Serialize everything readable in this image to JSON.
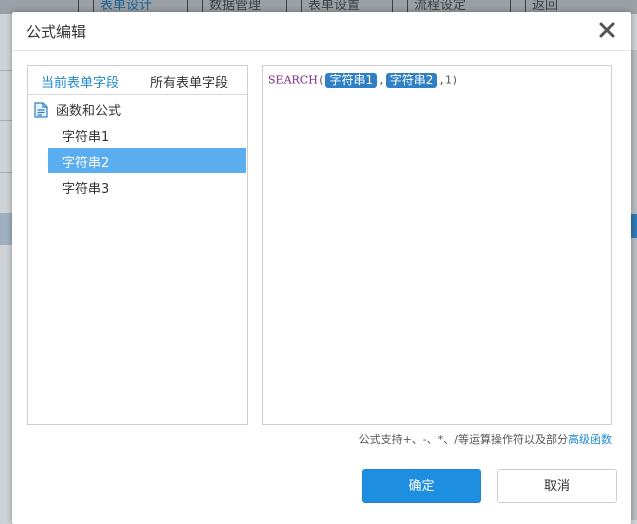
{
  "background_app": {
    "tabs": [
      {
        "label": "表单设计",
        "active": true
      },
      {
        "label": "数据管理",
        "active": false
      },
      {
        "label": "表单设置",
        "active": false
      },
      {
        "label": "流程设定",
        "active": false
      },
      {
        "label": "返回",
        "active": false
      }
    ]
  },
  "dialog": {
    "title": "公式编辑",
    "close_icon": "close-x-icon"
  },
  "left_panel": {
    "tabs": [
      {
        "label": "当前表单字段",
        "active": true
      },
      {
        "label": "所有表单字段",
        "active": false
      }
    ],
    "tree_root": {
      "label": "函数和公式",
      "icon": "document-icon"
    },
    "fields": [
      {
        "label": "字符串1",
        "selected": false
      },
      {
        "label": "字符串2",
        "selected": true
      },
      {
        "label": "字符串3",
        "selected": false
      }
    ]
  },
  "formula": {
    "function": "SEARCH",
    "open_paren": "(",
    "arg1": "字符串1",
    "comma1": ",",
    "arg2": "字符串2",
    "tail": ",1)"
  },
  "hint": {
    "text": "公式支持+、-、*、/等运算操作符以及部分",
    "link": "高级函数"
  },
  "buttons": {
    "ok": "确定",
    "cancel": "取消"
  },
  "colors": {
    "accent": "#1e8ee0",
    "selected_row": "#5aaef0",
    "chip": "#2f7fc4",
    "function_name": "#7a2b8a"
  }
}
